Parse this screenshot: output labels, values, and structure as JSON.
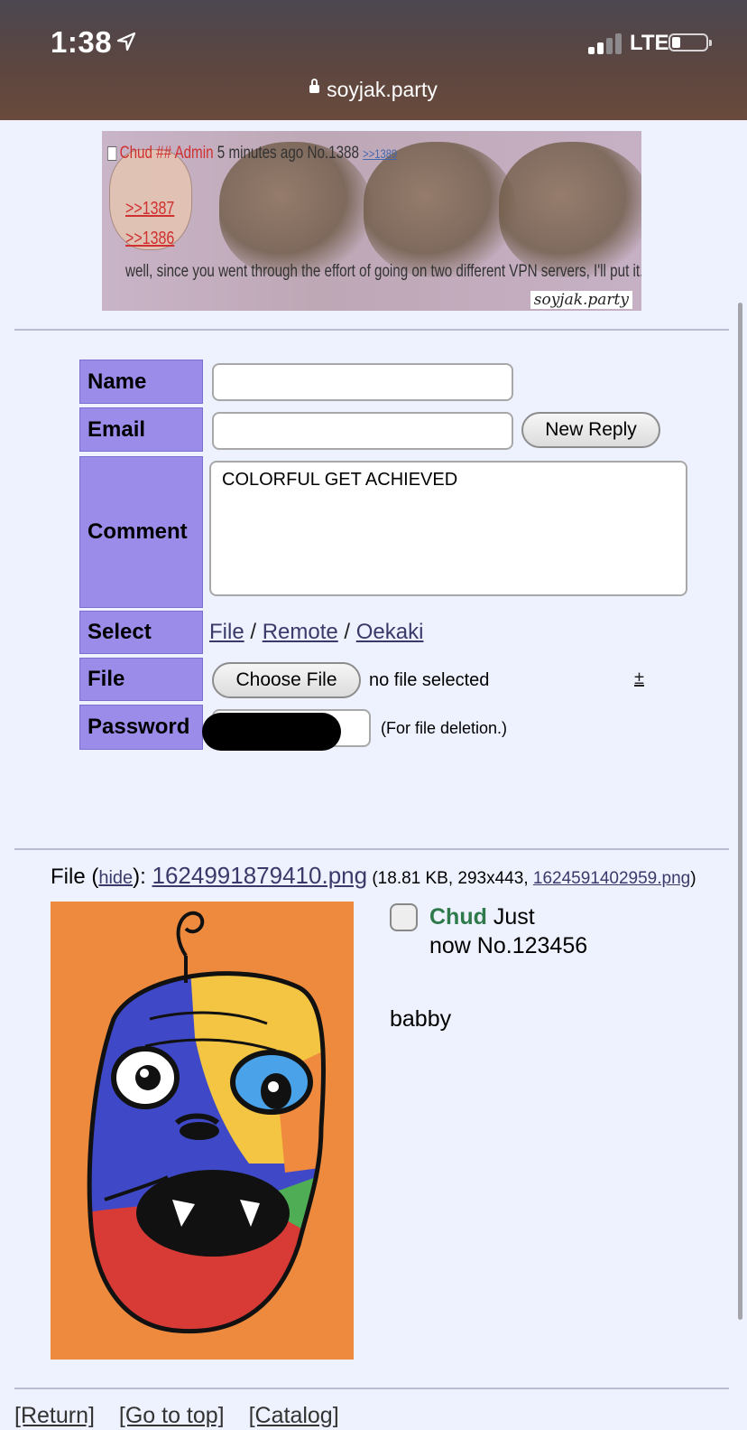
{
  "status_bar": {
    "time": "1:38",
    "network": "LTE"
  },
  "browser": {
    "url": "soyjak.party"
  },
  "banner": {
    "name": "Chud ## Admin",
    "when": "5 minutes ago No.1388",
    "backlink": ">>1389",
    "quote1": ">>1387",
    "quote2": ">>1386",
    "text": "well, since you went through the effort of going on two different VPN servers, I'll put it.",
    "watermark": "soyjak.party"
  },
  "form": {
    "name_label": "Name",
    "email_label": "Email",
    "comment_label": "Comment",
    "select_label": "Select",
    "file_label": "File",
    "password_label": "Password",
    "name_value": "",
    "email_value": "",
    "submit_label": "New Reply",
    "comment_value": "COLORFUL GET ACHIEVED",
    "select_options": [
      "File",
      "Remote",
      "Oekaki"
    ],
    "select_separator": "/",
    "choose_file_label": "Choose File",
    "no_file_text": "no file selected",
    "plus_label": "±",
    "password_note": "(For file deletion.)"
  },
  "post": {
    "file_prefix": "File (",
    "hide_label": "hide",
    "file_mid": "): ",
    "filename": "1624991879410.png",
    "meta": " (18.81 KB, 293x443, ",
    "original_name": "1624591402959.png",
    "meta_end": ")",
    "author": "Chud",
    "time_line1": " Just",
    "time_line2": "now No.123456",
    "body": "babby"
  },
  "footer": {
    "links": [
      "[Return]",
      "[Go to top]",
      "[Catalog]"
    ]
  },
  "colors": {
    "page_bg": "#eef2ff",
    "label_bg": "#9a8ce8",
    "name_green": "#2f7a4a",
    "thumb_bg": "#ee8a3e"
  }
}
